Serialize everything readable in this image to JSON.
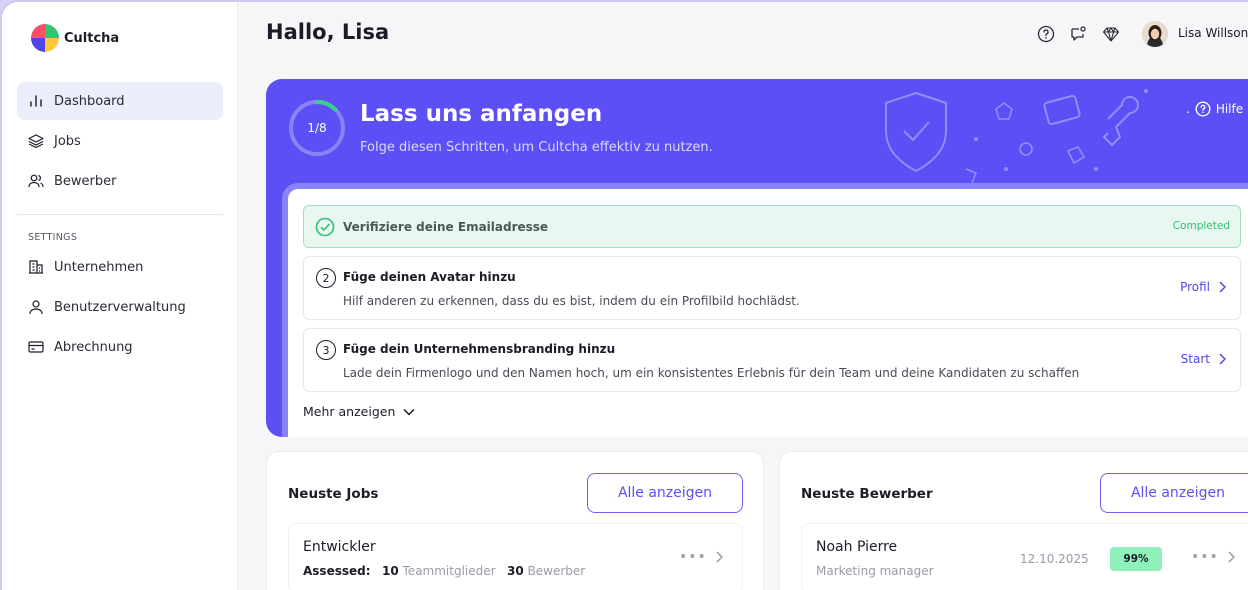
{
  "app": {
    "name": "Cultcha"
  },
  "sidebar": {
    "items": [
      {
        "label": "Dashboard",
        "icon": "bar-chart-icon",
        "active": true
      },
      {
        "label": "Jobs",
        "icon": "layers-icon"
      },
      {
        "label": "Bewerber",
        "icon": "users-icon"
      }
    ],
    "settings_label": "SETTINGS",
    "settings_items": [
      {
        "label": "Unternehmen",
        "icon": "building-icon"
      },
      {
        "label": "Benutzerverwaltung",
        "icon": "user-icon"
      },
      {
        "label": "Abrechnung",
        "icon": "credit-card-icon"
      }
    ]
  },
  "header": {
    "greeting": "Hallo, Lisa",
    "user_name": "Lisa Willson"
  },
  "onboarding": {
    "progress_text": "1/8",
    "progress_fraction": 0.125,
    "title": "Lass uns anfangen",
    "subtitle": "Folge diesen Schritten, um Cultcha effektiv zu nutzen.",
    "help_label": "Hilfe",
    "help_prefix": ".",
    "steps": [
      {
        "number": "",
        "title": "Verifiziere deine Emailadresse",
        "description": "",
        "action": "",
        "status": "Completed"
      },
      {
        "number": "2",
        "title": "Füge deinen Avatar hinzu",
        "description": "Hilf anderen zu erkennen, dass du es bist, indem du ein Profilbild hochlädst.",
        "action": "Profil"
      },
      {
        "number": "3",
        "title": "Füge dein Unternehmensbranding hinzu",
        "description": "Lade dein Firmenlogo und den Namen hoch, um ein konsistentes Erlebnis für dein Team und deine Kandidaten zu schaffen",
        "action": "Start"
      }
    ],
    "more_label": "Mehr anzeigen"
  },
  "jobs_card": {
    "title": "Neuste Jobs",
    "button_label": "Alle anzeigen",
    "rows": [
      {
        "title": "Entwickler",
        "status_label": "Assessed:",
        "team_count": "10",
        "team_label": "Teammitglieder",
        "applicant_count": "30",
        "applicant_label": "Bewerber"
      }
    ]
  },
  "applicants_card": {
    "title": "Neuste Bewerber",
    "button_label": "Alle anzeigen",
    "rows": [
      {
        "name": "Noah Pierre",
        "role": "Marketing manager",
        "date": "12.10.2025",
        "score": "99%"
      }
    ]
  },
  "colors": {
    "accent": "#5b4ff5",
    "success": "#2fbf76",
    "score_bg": "#8ff0bc"
  }
}
